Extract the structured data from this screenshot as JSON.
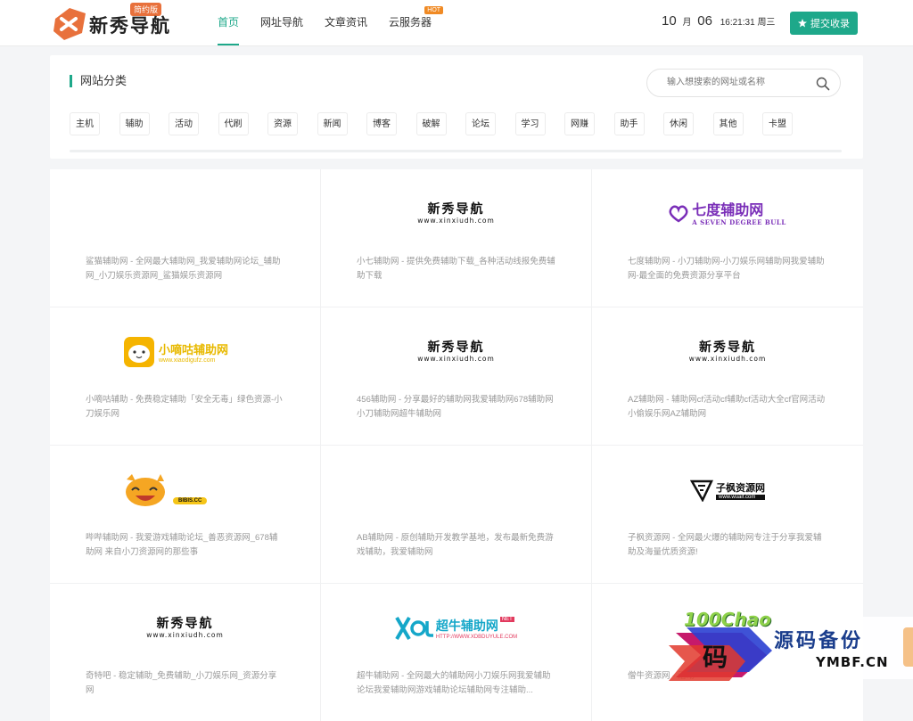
{
  "header": {
    "logo_text": "新秀导航",
    "logo_badge": "简约版",
    "nav": [
      {
        "label": "首页",
        "active": true
      },
      {
        "label": "网址导航"
      },
      {
        "label": "文章资讯"
      },
      {
        "label": "云服务器",
        "badge": "HOT"
      }
    ],
    "date": {
      "month": "10",
      "month_unit": "月",
      "day": "06",
      "time": "16:21:31",
      "weekday": "周三"
    },
    "submit_label": "提交收录"
  },
  "categories": {
    "title": "网站分类",
    "search_placeholder": "输入想搜索的网址或名称",
    "items": [
      "主机",
      "辅助",
      "活动",
      "代刷",
      "资源",
      "新闻",
      "博客",
      "破解",
      "论坛",
      "学习",
      "网赚",
      "助手",
      "休闲",
      "其他",
      "卡盟"
    ]
  },
  "cards": [
    {
      "logo": "none",
      "desc": "鲨猫辅助网 - 全网最大辅助网_我爱辅助网论坛_辅助网_小刀娱乐资源网_鲨猫娱乐资源网"
    },
    {
      "logo": "xinxiu",
      "logo_name": "新秀导航",
      "logo_url": "www.xinxiudh.com",
      "desc": "小七辅助网 - 提供免费辅助下载_各种活动线报免费辅助下载"
    },
    {
      "logo": "qidu",
      "logo_name": "七度辅助网",
      "logo_sub": "A SEVEN DEGREE BULL",
      "desc": "七度辅助网 - 小刀辅助网-小刀娱乐网辅助网我爱辅助网-最全面的免费资源分享平台"
    },
    {
      "logo": "xiaodigu",
      "logo_name": "小嘀咕辅助网",
      "logo_sub": "www.xiaodigufz.com",
      "desc": "小嘀咕辅助 - 免费稳定辅助「安全无毒」绿色资源-小刀娱乐网"
    },
    {
      "logo": "xinxiu",
      "logo_name": "新秀导航",
      "logo_url": "www.xinxiudh.com",
      "desc": "456辅助网 - 分享最好的辅助网我爱辅助网678辅助网小刀辅助网超牛辅助网"
    },
    {
      "logo": "xinxiu",
      "logo_name": "新秀导航",
      "logo_url": "www.xinxiudh.com",
      "desc": "AZ辅助网 - 辅助网cf活动cf辅助cf活动大全cf官网活动小偷娱乐网AZ辅助网"
    },
    {
      "logo": "bibis",
      "logo_sub": "BIBIS.CC",
      "desc": "哔哔辅助网 - 我爱游戏辅助论坛_善恶资源网_678辅助网 来自小刀资源网的那些事"
    },
    {
      "logo": "none",
      "desc": "AB辅助网 - 原创辅助开发教学基地，发布最新免费游戏辅助，我爱辅助网"
    },
    {
      "logo": "zifeng",
      "logo_name": "子枫资源网",
      "logo_sub": "www.wuaif.com",
      "desc": "子枫资源网 - 全网最火爆的辅助网专注于分享我爱辅助及海量优质资源!"
    },
    {
      "logo": "xinxiu",
      "logo_name": "新秀导航",
      "logo_url": "www.xinxiudh.com",
      "desc": "奇特吧 - 稳定辅助_免费辅助_小刀娱乐网_资源分享网"
    },
    {
      "logo": "chaoniu",
      "logo_name": "超牛辅助网",
      "logo_badge": "NET",
      "logo_sub": "HTTP://WWW.XDBDUYULE.COM",
      "desc": "超牛辅助网 - 全网最大的辅助网小刀娱乐网我爱辅助论坛我爱辅助网游戏辅助论坛辅助网专注辅助..."
    },
    {
      "logo": "green",
      "logo_name": "100Chao",
      "desc": "僧牛资源网 - 活动"
    }
  ],
  "watermark": {
    "char": "码",
    "title": "源码备份",
    "sub": "YMBF.CN"
  },
  "colors": {
    "accent": "#1ea88a",
    "hot": "#f08a24",
    "logo_orange": "#e8713c"
  }
}
